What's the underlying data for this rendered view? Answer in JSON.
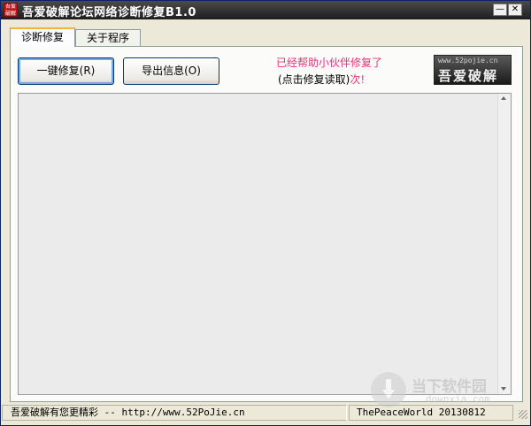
{
  "window": {
    "title": "吾爱破解论坛网络诊断修复B1.0",
    "icon_text": "吾爱破解",
    "minimize_glyph": "—",
    "close_glyph": "✕"
  },
  "tabs": [
    {
      "label": "诊断修复",
      "active": true
    },
    {
      "label": "关于程序",
      "active": false
    }
  ],
  "buttons": {
    "repair": "一键修复(R)",
    "export": "导出信息(O)"
  },
  "message": {
    "line1": "已经帮助小伙伴修复了",
    "line2": "(点击修复读取)",
    "line2_suffix": "次!"
  },
  "logo": {
    "url": "www.52pojie.cn",
    "text": "吾爱破解"
  },
  "log": {
    "content": ""
  },
  "watermark": {
    "title": "当下软件园",
    "subtitle": "downxia.com"
  },
  "status": {
    "left": "吾爱破解有您更精彩 -- http://www.52PoJie.cn",
    "right": "ThePeaceWorld 20130812"
  },
  "colors": {
    "accent_pink": "#e8337a",
    "tab_highlight": "#f8b33a",
    "titlebar": "#2e2e2e"
  }
}
